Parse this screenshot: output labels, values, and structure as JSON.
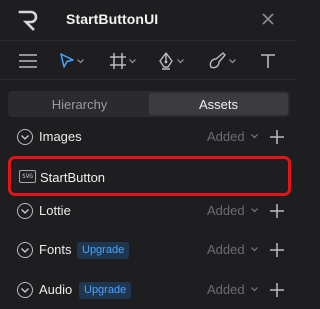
{
  "header": {
    "title": "StartButtonUI"
  },
  "toolbar": {
    "tools": [
      "menu-icon",
      "select-arrow-icon",
      "frame-icon",
      "pen-icon",
      "brush-icon",
      "text-icon"
    ]
  },
  "tabs": [
    {
      "label": "Hierarchy",
      "active": false
    },
    {
      "label": "Assets",
      "active": true
    }
  ],
  "sections": {
    "images": {
      "title": "Images",
      "status": "Added"
    },
    "lottie": {
      "title": "Lottie",
      "status": "Added"
    },
    "fonts": {
      "title": "Fonts",
      "badge": "Upgrade",
      "status": "Added"
    },
    "audio": {
      "title": "Audio",
      "badge": "Upgrade",
      "status": "Added"
    }
  },
  "assets": [
    {
      "name": "StartButton",
      "icon_text": "SVG"
    }
  ],
  "colors": {
    "background": "#1e1e20",
    "accent_blue": "#4aa3ff",
    "highlight_red": "#e5141c"
  }
}
